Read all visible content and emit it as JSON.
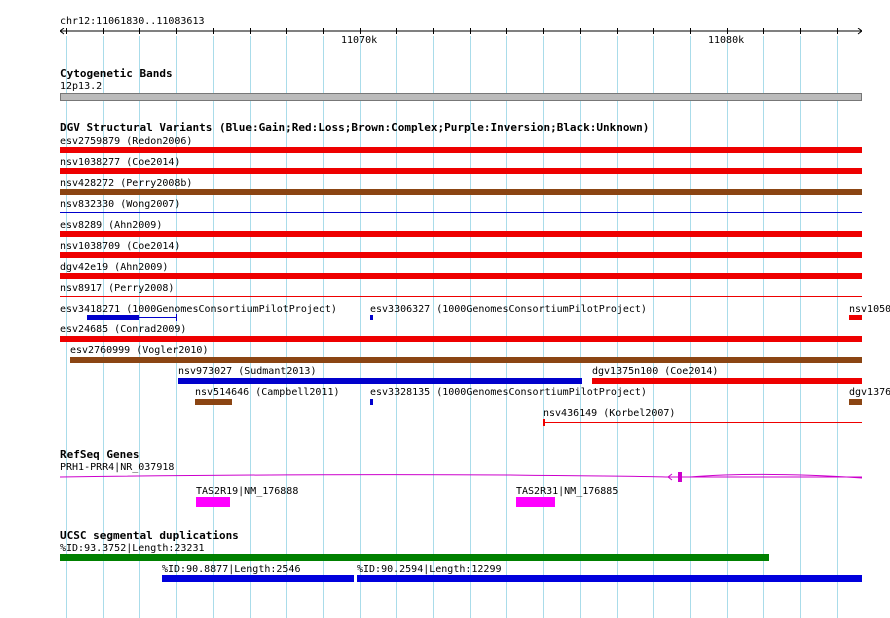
{
  "ruler": {
    "location": "chr12:11061830..11083613",
    "ticks": [
      "11070k",
      "11080k"
    ]
  },
  "cytoband": {
    "title": "Cytogenetic Bands",
    "band": "12p13.2"
  },
  "dgv": {
    "title": "DGV Structural Variants (Blue:Gain;Red:Loss;Brown:Complex;Purple:Inversion;Black:Unknown)",
    "colors": {
      "gain": "#0000cc",
      "loss": "#ee0000",
      "complex": "#8b4513",
      "inversion": "#800080",
      "unknown": "#000000"
    },
    "features": [
      {
        "label": "esv2759879 (Redon2006)",
        "type": "loss"
      },
      {
        "label": "nsv1038277 (Coe2014)",
        "type": "loss"
      },
      {
        "label": "nsv428272 (Perry2008b)",
        "type": "complex"
      },
      {
        "label": "nsv832330 (Wong2007)",
        "type": "gain"
      },
      {
        "label": "esv8289 (Ahn2009)",
        "type": "loss"
      },
      {
        "label": "nsv1038709 (Coe2014)",
        "type": "loss"
      },
      {
        "label": "dgv42e19 (Ahn2009)",
        "type": "loss"
      },
      {
        "label": "nsv8917 (Perry2008)",
        "type": "loss"
      },
      {
        "label": "esv3418271 (1000GenomesConsortiumPilotProject)",
        "type": "gain"
      },
      {
        "label": "esv3306327 (1000GenomesConsortiumPilotProject)",
        "type": "gain"
      },
      {
        "label": "nsv1050",
        "type": "loss"
      },
      {
        "label": "esv24685 (Conrad2009)",
        "type": "loss"
      },
      {
        "label": "esv2760999 (Vogler2010)",
        "type": "complex"
      },
      {
        "label": "nsv973027 (Sudmant2013)",
        "type": "gain"
      },
      {
        "label": "dgv1375n100 (Coe2014)",
        "type": "loss"
      },
      {
        "label": "nsv514646 (Campbell2011)",
        "type": "complex"
      },
      {
        "label": "esv3328135 (1000GenomesConsortiumPilotProject)",
        "type": "gain"
      },
      {
        "label": "dgv1376",
        "type": "complex"
      },
      {
        "label": "nsv436149 (Korbel2007)",
        "type": "loss"
      }
    ]
  },
  "refseq": {
    "title": "RefSeq Genes",
    "genes": [
      {
        "label": "PRH1-PRR4|NR_037918"
      },
      {
        "label": "TAS2R19|NM_176888"
      },
      {
        "label": "TAS2R31|NM_176885"
      }
    ],
    "color": "#cc00cc"
  },
  "segdups": {
    "title": "UCSC segmental duplications",
    "items": [
      {
        "label": "%ID:93.3752|Length:23231",
        "color": "#008000"
      },
      {
        "label": "%ID:90.8877|Length:2546",
        "color": "#0000dd"
      },
      {
        "label": "%ID:90.2594|Length:12299",
        "color": "#0000dd"
      }
    ]
  }
}
